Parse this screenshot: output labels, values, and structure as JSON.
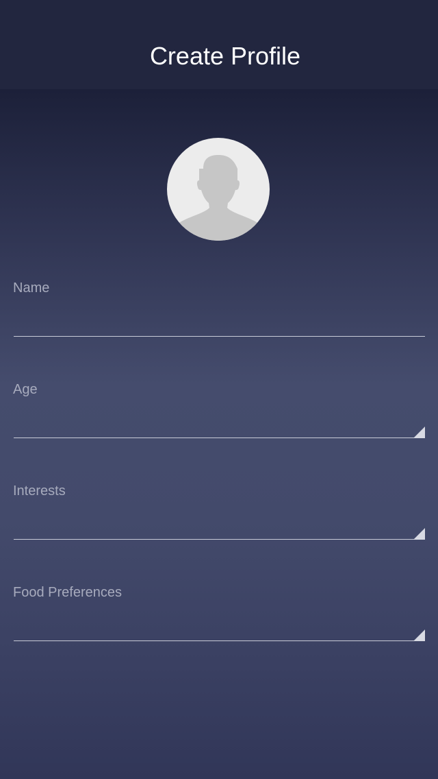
{
  "header": {
    "title": "Create Profile"
  },
  "avatar": {
    "icon": "user-silhouette-icon"
  },
  "form": {
    "name": {
      "label": "Name",
      "value": "",
      "placeholder": ""
    },
    "age": {
      "label": "Age",
      "value": ""
    },
    "interests": {
      "label": "Interests",
      "value": ""
    },
    "food_preferences": {
      "label": "Food Preferences",
      "value": ""
    }
  },
  "colors": {
    "header_bg": "#22263f",
    "background_top": "#1c2039",
    "background_mid": "#454c6d",
    "label": "#a7abbd",
    "underline": "#c9ccd8"
  }
}
